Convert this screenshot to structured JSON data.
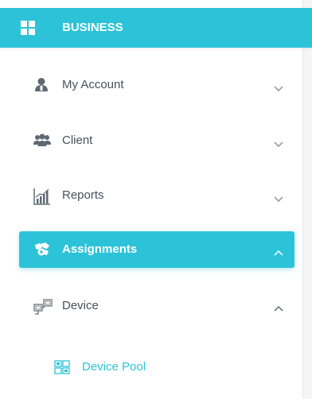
{
  "header": {
    "title": "BUSINESS",
    "icon": "grid-icon",
    "accent_color": "#2cc3d8"
  },
  "menu": {
    "items": [
      {
        "label": "My Account",
        "icon": "user-icon",
        "state": "collapsed"
      },
      {
        "label": "Client",
        "icon": "users-icon",
        "state": "collapsed"
      },
      {
        "label": "Reports",
        "icon": "bar-chart-icon",
        "state": "collapsed"
      },
      {
        "label": "Assignments",
        "icon": "assignments-icon",
        "state": "expanded",
        "active": true
      },
      {
        "label": "Device",
        "icon": "device-icon",
        "state": "expanded"
      }
    ],
    "sub_items": [
      {
        "label": "Device Pool",
        "icon": "device-pool-icon",
        "selected": true
      }
    ]
  }
}
